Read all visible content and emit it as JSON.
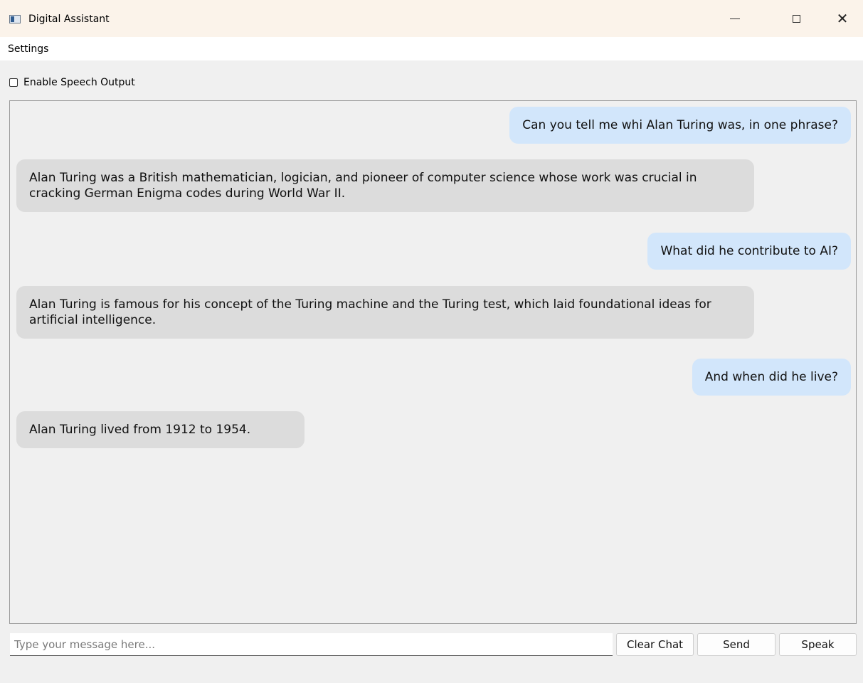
{
  "window": {
    "title": "Digital Assistant",
    "icons": {
      "app": "app-window-icon",
      "minimize": "minimize-icon",
      "maximize": "maximize-icon",
      "close": "close-icon"
    },
    "close_glyph": "✕"
  },
  "menu": {
    "items": [
      {
        "label": "Settings"
      }
    ]
  },
  "speech_option": {
    "label": "Enable Speech Output",
    "checked": false
  },
  "chat": {
    "messages": [
      {
        "role": "user",
        "text": "Can you tell me whi Alan Turing was, in one phrase?"
      },
      {
        "role": "assistant",
        "text": "Alan Turing was a British mathematician, logician, and pioneer of computer science whose work was crucial in cracking German Enigma codes during World War II."
      },
      {
        "role": "user",
        "text": "What did he contribute to AI?"
      },
      {
        "role": "assistant",
        "text": "Alan Turing is famous for his concept of the Turing machine and the Turing test, which laid foundational ideas for artificial intelligence."
      },
      {
        "role": "user",
        "text": "And when did he live?"
      },
      {
        "role": "assistant",
        "text": "Alan Turing lived from 1912 to 1954."
      }
    ]
  },
  "composer": {
    "placeholder": "Type your message here...",
    "value": "",
    "clear_label": "Clear Chat",
    "send_label": "Send",
    "speak_label": "Speak"
  },
  "colors": {
    "titlebar_bg": "#fbf3ea",
    "user_bubble": "#d2e6fb",
    "assistant_bubble": "#dcdcdc",
    "window_bg": "#f0f0f0"
  }
}
